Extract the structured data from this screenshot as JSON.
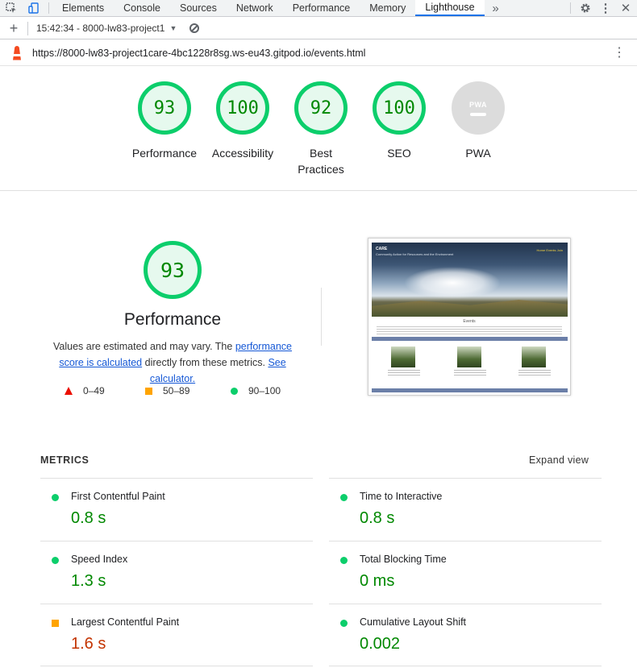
{
  "devtools": {
    "tabs": [
      "Elements",
      "Console",
      "Sources",
      "Network",
      "Performance",
      "Memory",
      "Lighthouse"
    ],
    "active_tab": "Lighthouse",
    "more_icon": "chevron-double-right-icon"
  },
  "toolbar": {
    "report_label": "15:42:34 - 8000-lw83-project1"
  },
  "url": "https://8000-lw83-project1care-4bc1228r8sg.ws-eu43.gitpod.io/events.html",
  "gauges": [
    {
      "score": "93",
      "label": "Performance"
    },
    {
      "score": "100",
      "label": "Accessibility"
    },
    {
      "score": "92",
      "label": "Best Practices"
    },
    {
      "score": "100",
      "label": "SEO"
    },
    {
      "score": "",
      "label": "PWA",
      "badge": "PWA"
    }
  ],
  "performance": {
    "score": "93",
    "title": "Performance",
    "note_prefix": "Values are estimated and may vary. The ",
    "note_link": "performance score is calculated",
    "note_middle": " directly from these metrics. ",
    "note_link2": "See calculator.",
    "legend": [
      "0–49",
      "50–89",
      "90–100"
    ]
  },
  "thumbnail": {
    "brand": "CARE",
    "tagline": "Community Action for Resources and the Environment",
    "nav": "Home   Events   Join",
    "heading": "Events"
  },
  "metrics": {
    "header": "METRICS",
    "expand_label": "Expand view",
    "items": [
      {
        "label": "First Contentful Paint",
        "value": "0.8 s",
        "rating": "good"
      },
      {
        "label": "Time to Interactive",
        "value": "0.8 s",
        "rating": "good"
      },
      {
        "label": "Speed Index",
        "value": "1.3 s",
        "rating": "good"
      },
      {
        "label": "Total Blocking Time",
        "value": "0 ms",
        "rating": "good"
      },
      {
        "label": "Largest Contentful Paint",
        "value": "1.6 s",
        "rating": "average"
      },
      {
        "label": "Cumulative Layout Shift",
        "value": "0.002",
        "rating": "good"
      }
    ]
  },
  "colors": {
    "pass": "#0cce6b",
    "average": "#ffa400",
    "fail": "#eb0f00",
    "accent": "#1a73e8"
  }
}
